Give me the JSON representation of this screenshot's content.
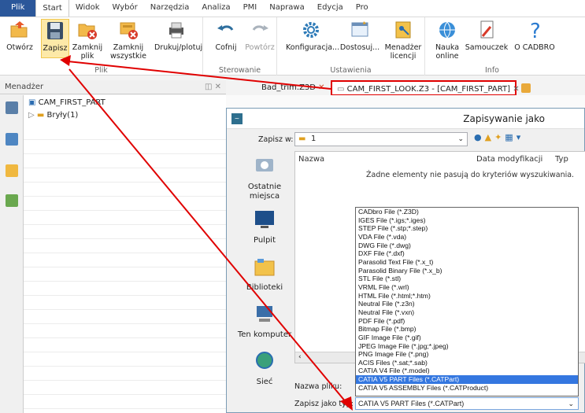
{
  "menu": {
    "tabs": [
      "Plik",
      "Start",
      "Widok",
      "Wybór",
      "Narzędzia",
      "Analiza",
      "PMI",
      "Naprawa",
      "Edycja",
      "Pro"
    ],
    "active": "Start"
  },
  "ribbon": {
    "buttons": {
      "otworz": "Otwórz",
      "zapisz": "Zapisz",
      "zamknij": "Zamknij plik",
      "zamknij_all": "Zamknij wszystkie...",
      "drukuj": "Drukuj/plotuj",
      "cofnij": "Cofnij",
      "powtorz": "Powtórz",
      "konfiguracja": "Konfiguracja...",
      "dostosuj": "Dostosuj...",
      "menadzer_lic": "Menadżer licencji",
      "nauka": "Nauka online",
      "samouczek": "Samouczek",
      "o_cadbro": "O CADBRO"
    },
    "groups": {
      "plik": "Plik",
      "sterowanie": "Sterowanie",
      "ustawienia": "Ustawienia",
      "info": "Info"
    }
  },
  "panel": {
    "title": "Menadżer",
    "tree_root": "CAM_FIRST_PART",
    "tree_child": "Bryły(1)"
  },
  "doc_tabs": {
    "tab1": "Bad_trim.Z3D",
    "tab2": "CAM_FIRST_LOOK.Z3 - [CAM_FIRST_PART]"
  },
  "dialog": {
    "title": "Zapisywanie jako",
    "save_in_label": "Zapisz w:",
    "save_in_value": "1",
    "places": [
      "Ostatnie miejsca",
      "Pulpit",
      "Biblioteki",
      "Ten komputer",
      "Sieć"
    ],
    "columns": [
      "Nazwa",
      "Data modyfikacji",
      "Typ"
    ],
    "empty_message": "Żadne elementy nie pasują do kryteriów wyszukiwania.",
    "filename_label": "Nazwa pliku:",
    "filetype_label": "Zapisz jako typ:",
    "filetype_value": "CATIA V5 PART Files (*.CATPart)",
    "filetypes": [
      "CADbro File (*.Z3D)",
      "IGES File (*.igs;*.iges)",
      "STEP File (*.stp;*.step)",
      "VDA File (*.vda)",
      "DWG File (*.dwg)",
      "DXF File (*.dxf)",
      "Parasolid Text File (*.x_t)",
      "Parasolid Binary File (*.x_b)",
      "STL File (*.stl)",
      "VRML File (*.wrl)",
      "HTML File (*.html;*.htm)",
      "Neutral File (*.z3n)",
      "Neutral File (*.vxn)",
      "PDF File (*.pdf)",
      "Bitmap File (*.bmp)",
      "GIF Image File (*.gif)",
      "JPEG Image File (*.jpg;*.jpeg)",
      "PNG Image File (*.png)",
      "ACIS Files (*.sat;*.sab)",
      "CATIA V4 File (*.model)",
      "CATIA V5 PART Files (*.CATPart)",
      "CATIA V5 ASSEMBLY Files (*.CATProduct)"
    ],
    "selected_index": 20
  },
  "colors": {
    "file_tab": "#2b579a",
    "highlight": "#e00000",
    "selection": "#3477e0"
  }
}
